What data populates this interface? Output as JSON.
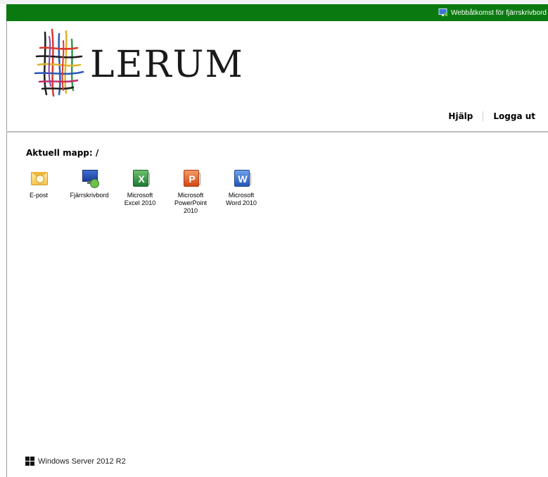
{
  "window": {
    "title": "Webbåtkomst för fjärrskrivbord",
    "bar_color": "#0a7a10",
    "icon": "remote-desktop-icon"
  },
  "brand": {
    "name": "LERUM",
    "logo": "lerum-weave-logo"
  },
  "nav": {
    "help": "Hjälp",
    "logout": "Logga ut"
  },
  "folder": {
    "label": "Aktuell mapp: /"
  },
  "apps": [
    {
      "label": "E-post",
      "icon": "outlook-envelope-icon"
    },
    {
      "label": "Fjärrskrivbord",
      "icon": "remote-desktop-icon"
    },
    {
      "label": "Microsoft\nExcel 2010",
      "icon": "excel-icon"
    },
    {
      "label": "Microsoft\nPowerPoint\n2010",
      "icon": "powerpoint-icon"
    },
    {
      "label": "Microsoft\nWord 2010",
      "icon": "word-icon"
    }
  ],
  "footer": {
    "text": "Windows Server 2012 R2",
    "icon": "windows-logo-icon"
  }
}
